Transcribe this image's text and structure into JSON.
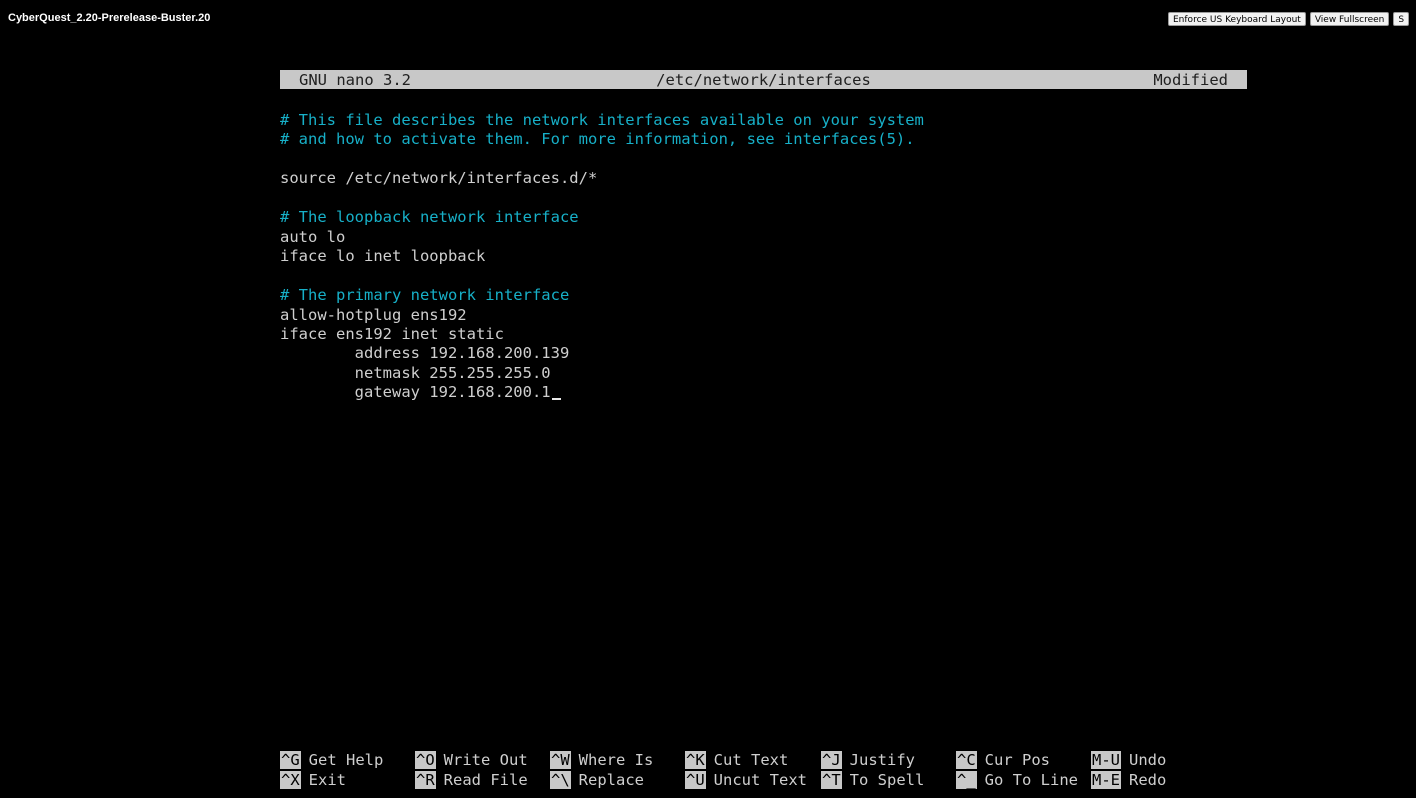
{
  "window": {
    "title": "CyberQuest_2.20-Prerelease-Buster.20",
    "buttons": [
      "Enforce US Keyboard Layout",
      "View Fullscreen",
      "S"
    ]
  },
  "nano": {
    "version": "GNU nano 3.2",
    "filename": "/etc/network/interfaces",
    "status": "Modified"
  },
  "file_lines": [
    {
      "type": "comment",
      "text": "# This file describes the network interfaces available on your system"
    },
    {
      "type": "comment",
      "text": "# and how to activate them. For more information, see interfaces(5)."
    },
    {
      "type": "blank",
      "text": ""
    },
    {
      "type": "code",
      "text": "source /etc/network/interfaces.d/*"
    },
    {
      "type": "blank",
      "text": ""
    },
    {
      "type": "comment",
      "text": "# The loopback network interface"
    },
    {
      "type": "code",
      "text": "auto lo"
    },
    {
      "type": "code",
      "text": "iface lo inet loopback"
    },
    {
      "type": "blank",
      "text": ""
    },
    {
      "type": "comment",
      "text": "# The primary network interface"
    },
    {
      "type": "code",
      "text": "allow-hotplug ens192"
    },
    {
      "type": "code",
      "text": "iface ens192 inet static"
    },
    {
      "type": "code",
      "text": "        address 192.168.200.139"
    },
    {
      "type": "code",
      "text": "        netmask 255.255.255.0"
    },
    {
      "type": "code",
      "text": "        gateway 192.168.200.1"
    }
  ],
  "shortcuts": [
    [
      {
        "key": "^G",
        "label": "Get Help"
      },
      {
        "key": "^O",
        "label": "Write Out"
      },
      {
        "key": "^W",
        "label": "Where Is"
      },
      {
        "key": "^K",
        "label": "Cut Text"
      },
      {
        "key": "^J",
        "label": "Justify"
      },
      {
        "key": "^C",
        "label": "Cur Pos"
      },
      {
        "key": "M-U",
        "label": "Undo"
      }
    ],
    [
      {
        "key": "^X",
        "label": "Exit"
      },
      {
        "key": "^R",
        "label": "Read File"
      },
      {
        "key": "^\\",
        "label": "Replace"
      },
      {
        "key": "^U",
        "label": "Uncut Text"
      },
      {
        "key": "^T",
        "label": "To Spell"
      },
      {
        "key": "^_",
        "label": "Go To Line"
      },
      {
        "key": "M-E",
        "label": "Redo"
      }
    ]
  ],
  "colors": {
    "background": "#000000",
    "comment": "#17b0c8",
    "text": "#cfcfcf",
    "header_bg": "#c8c8c8"
  }
}
